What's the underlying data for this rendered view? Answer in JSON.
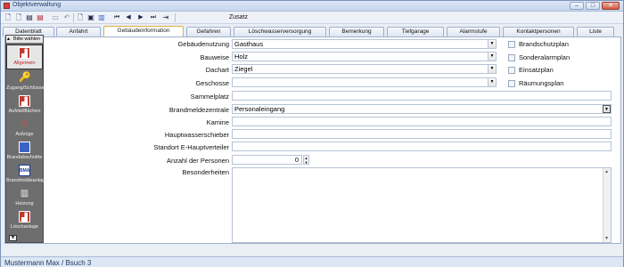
{
  "window": {
    "title": "Objektverwaltung",
    "buttons": {
      "minimize": "–",
      "maximize": "□",
      "close": "✕"
    }
  },
  "toolbar": {
    "zusatz_label": "Zusatz",
    "icons": [
      "new-doc-icon",
      "copy-doc-icon",
      "new-record-icon",
      "delete-icon",
      "save-icon",
      "undo-icon",
      "preview-icon",
      "print-icon",
      "search-icon",
      "first-icon",
      "prev-icon",
      "next-icon",
      "last-icon",
      "exit-icon"
    ]
  },
  "tabs": [
    {
      "label": "Datenblatt"
    },
    {
      "label": "Anfahrt"
    },
    {
      "label": "Gebäudeinformation",
      "active": true
    },
    {
      "label": "Gefahren"
    },
    {
      "label": "Löschwasserversorgung"
    },
    {
      "label": "Bemerkung"
    },
    {
      "label": "Tiefgarage"
    },
    {
      "label": "Alarmstufe"
    },
    {
      "label": "Kontaktpersonen"
    },
    {
      "label": "Liste"
    }
  ],
  "sidebar": {
    "header": "Bitte wählen Sie:",
    "items": [
      {
        "label": "Allgemein",
        "icon": "fire-truck-icon",
        "active": true
      },
      {
        "label": "Zugang/Schlüssel",
        "icon": "key-icon"
      },
      {
        "label": "Aufstellflächen",
        "icon": "fire-truck-icon"
      },
      {
        "label": "Aufzüge",
        "icon": "elevator-icon"
      },
      {
        "label": "Brandabschnitte",
        "icon": "door-icon"
      },
      {
        "label": "Brandmeldeanlage",
        "icon": "bma-icon"
      },
      {
        "label": "Heizung",
        "icon": "radiator-icon"
      },
      {
        "label": "Löschanlage",
        "icon": "fire-truck-icon"
      }
    ]
  },
  "form": {
    "gebaeudenutzung": {
      "label": "Gebäudenutzung",
      "value": "Gasthaus"
    },
    "bauweise": {
      "label": "Bauweise",
      "value": "Holz"
    },
    "dachart": {
      "label": "Dachart",
      "value": "Ziegel"
    },
    "geschosse": {
      "label": "Geschosse",
      "value": ""
    },
    "sammelplatz": {
      "label": "Sammelplatz",
      "value": ""
    },
    "brandmeldezentrale": {
      "label": "Brandmeldezentrale",
      "value": "Personaleingang"
    },
    "kamine": {
      "label": "Kamine",
      "value": ""
    },
    "hauptwasserschieber": {
      "label": "Hauptwasserschieber",
      "value": ""
    },
    "standort_e_hauptverteiler": {
      "label": "Standort E-Hauptverteiler",
      "value": ""
    },
    "anzahl_personen": {
      "label": "Anzahl der Personen",
      "value": "0"
    },
    "besonderheiten": {
      "label": "Besonderheiten",
      "value": ""
    }
  },
  "checkboxes": [
    {
      "label": "Brandschutzplan",
      "checked": false
    },
    {
      "label": "Sonderalarmplan",
      "checked": false
    },
    {
      "label": "Einsatzplan",
      "checked": false
    },
    {
      "label": "Räumungsplan",
      "checked": false
    }
  ],
  "status": {
    "text": "Mustermann Max / Bsuch 3"
  }
}
